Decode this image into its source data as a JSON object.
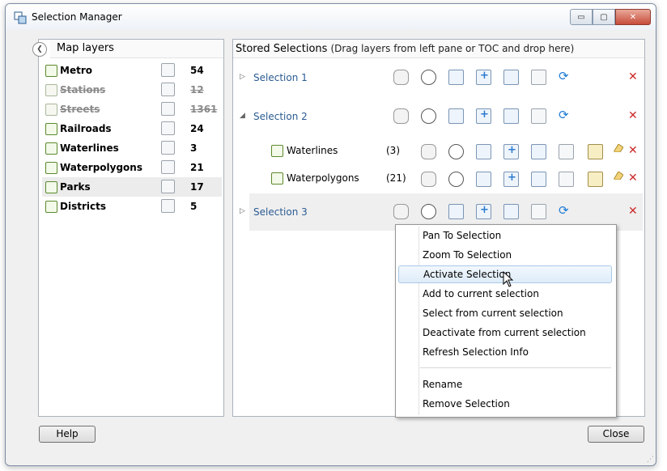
{
  "window": {
    "title": "Selection Manager",
    "controls": {
      "minimize": "▭",
      "maximize": "▢",
      "close": "✕"
    }
  },
  "left": {
    "header": "Map layers",
    "layers": [
      {
        "name": "Metro",
        "count": "54",
        "disabled": false
      },
      {
        "name": "Stations",
        "count": "12",
        "disabled": true
      },
      {
        "name": "Streets",
        "count": "1361",
        "disabled": true
      },
      {
        "name": "Railroads",
        "count": "24",
        "disabled": false
      },
      {
        "name": "Waterlines",
        "count": "3",
        "disabled": false
      },
      {
        "name": "Waterpolygons",
        "count": "21",
        "disabled": false
      },
      {
        "name": "Parks",
        "count": "17",
        "disabled": false,
        "selected": true
      },
      {
        "name": "Districts",
        "count": "5",
        "disabled": false
      }
    ]
  },
  "right": {
    "header": "Stored Selections",
    "hint": "(Drag layers from left pane or TOC and drop here)",
    "selections": [
      {
        "name": "Selection 1",
        "expanded": false
      },
      {
        "name": "Selection 2",
        "expanded": true,
        "children": [
          {
            "name": "Waterlines",
            "count": "(3)"
          },
          {
            "name": "Waterpolygons",
            "count": "(21)"
          }
        ]
      },
      {
        "name": "Selection 3",
        "expanded": false
      }
    ]
  },
  "context_menu": {
    "items": [
      "Pan To Selection",
      "Zoom To Selection",
      "Activate Selection",
      "Add to current selection",
      "Select from current selection",
      "Deactivate from current selection",
      "Refresh Selection Info",
      "Rename",
      "Remove Selection"
    ],
    "highlighted": "Activate Selection"
  },
  "buttons": {
    "help": "Help",
    "close": "Close"
  },
  "icons": {
    "collapsed": "▷",
    "expanded": "◢",
    "back": "❮",
    "delete": "✕",
    "refresh": "⟳"
  },
  "colors": {
    "link": "#2a5b92",
    "delete": "#cc2a2a",
    "accent": "#1e7bd6"
  }
}
